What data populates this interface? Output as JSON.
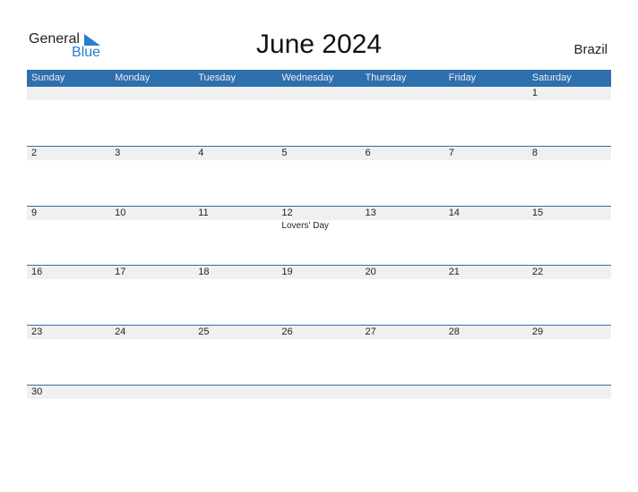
{
  "logo": {
    "line1": "General",
    "line2": "Blue"
  },
  "title": "June 2024",
  "country": "Brazil",
  "colors": {
    "accent": "#2e6fad",
    "band": "#f0f0f0",
    "logo_blue": "#2a7dc8"
  },
  "weekdays": [
    "Sunday",
    "Monday",
    "Tuesday",
    "Wednesday",
    "Thursday",
    "Friday",
    "Saturday"
  ],
  "weeks": [
    [
      {
        "d": ""
      },
      {
        "d": ""
      },
      {
        "d": ""
      },
      {
        "d": ""
      },
      {
        "d": ""
      },
      {
        "d": ""
      },
      {
        "d": "1"
      }
    ],
    [
      {
        "d": "2"
      },
      {
        "d": "3"
      },
      {
        "d": "4"
      },
      {
        "d": "5"
      },
      {
        "d": "6"
      },
      {
        "d": "7"
      },
      {
        "d": "8"
      }
    ],
    [
      {
        "d": "9"
      },
      {
        "d": "10"
      },
      {
        "d": "11"
      },
      {
        "d": "12",
        "event": "Lovers' Day"
      },
      {
        "d": "13"
      },
      {
        "d": "14"
      },
      {
        "d": "15"
      }
    ],
    [
      {
        "d": "16"
      },
      {
        "d": "17"
      },
      {
        "d": "18"
      },
      {
        "d": "19"
      },
      {
        "d": "20"
      },
      {
        "d": "21"
      },
      {
        "d": "22"
      }
    ],
    [
      {
        "d": "23"
      },
      {
        "d": "24"
      },
      {
        "d": "25"
      },
      {
        "d": "26"
      },
      {
        "d": "27"
      },
      {
        "d": "28"
      },
      {
        "d": "29"
      }
    ],
    [
      {
        "d": "30"
      },
      {
        "d": ""
      },
      {
        "d": ""
      },
      {
        "d": ""
      },
      {
        "d": ""
      },
      {
        "d": ""
      },
      {
        "d": ""
      }
    ]
  ]
}
